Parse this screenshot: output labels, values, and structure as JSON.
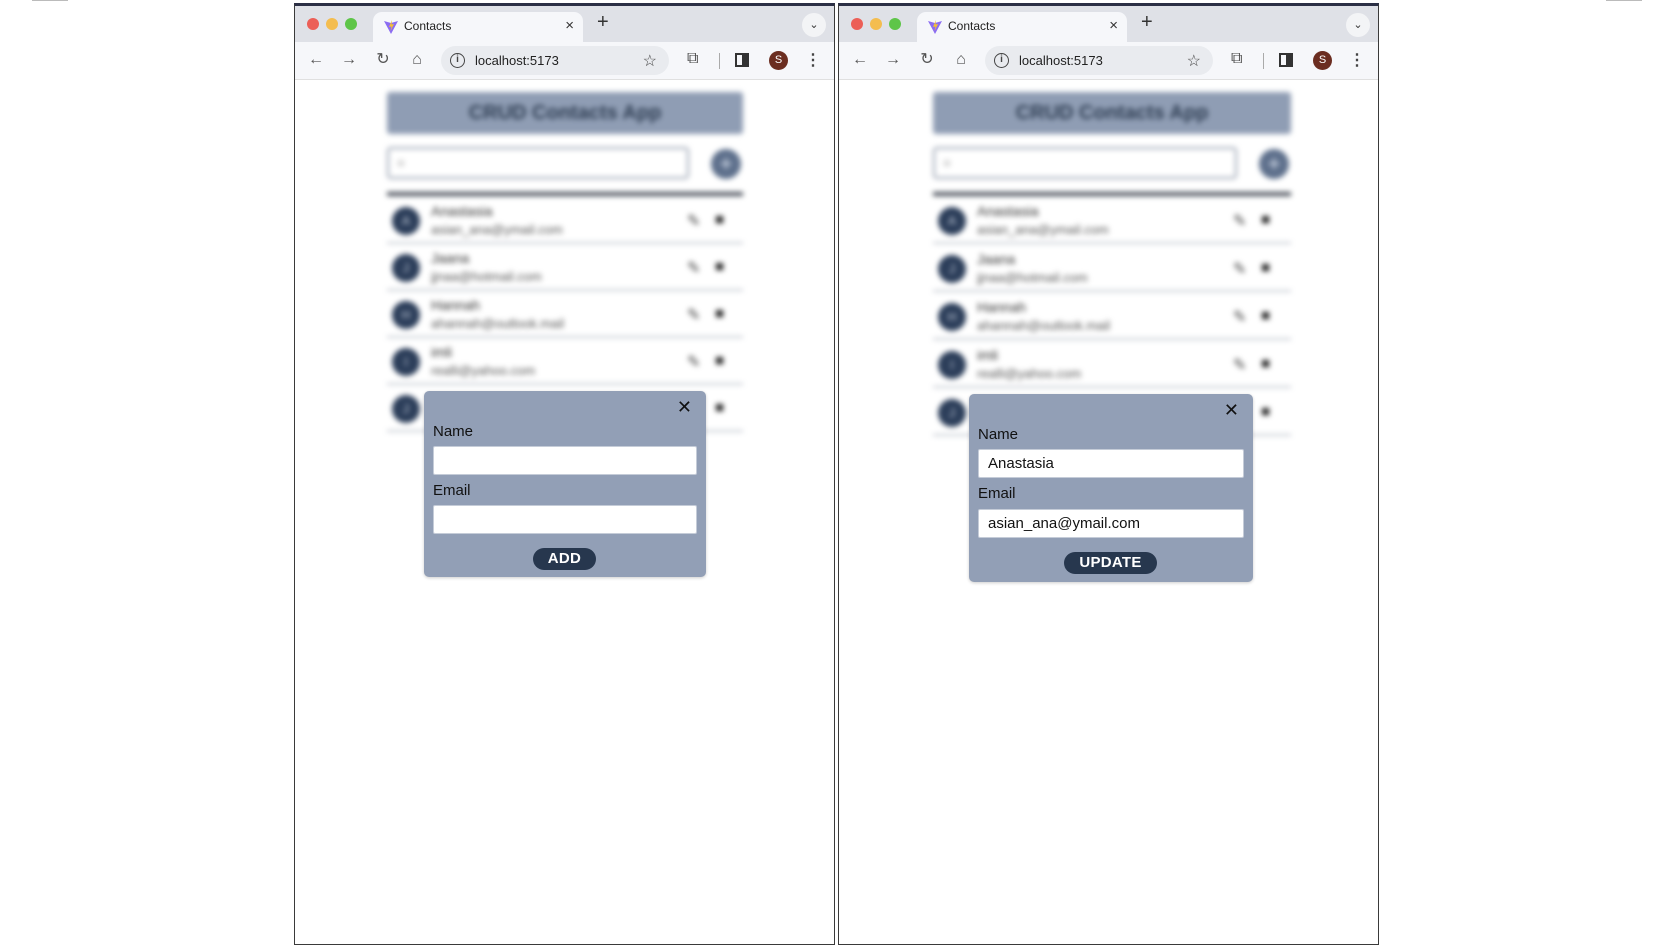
{
  "browser_left": {
    "tab_title": "Contacts",
    "url": "localhost:5173",
    "profile_initial": "S",
    "app": {
      "title": "CRUD Contacts App",
      "contacts": [
        {
          "initial": "A",
          "name": "Anastasia",
          "email": "asian_ana@ymail.com"
        },
        {
          "initial": "J",
          "name": "Jaana",
          "email": "jjnaa@hotmail.com"
        },
        {
          "initial": "H",
          "name": "Hannah",
          "email": "ahannah@outlook.mail"
        },
        {
          "initial": "I",
          "name": "imli",
          "email": "realli@yahoo.com"
        },
        {
          "initial": "J",
          "name": "",
          "email": ""
        }
      ]
    },
    "modal": {
      "name_label": "Name",
      "name_value": "",
      "email_label": "Email",
      "email_value": "",
      "button_label": "ADD"
    }
  },
  "browser_right": {
    "tab_title": "Contacts",
    "url": "localhost:5173",
    "profile_initial": "S",
    "app": {
      "title": "CRUD Contacts App",
      "contacts": [
        {
          "initial": "A",
          "name": "Anastasia",
          "email": "asian_ana@ymail.com"
        },
        {
          "initial": "J",
          "name": "Jaana",
          "email": "jjnaa@hotmail.com"
        },
        {
          "initial": "H",
          "name": "Hannah",
          "email": "ahannah@outlook.mail"
        },
        {
          "initial": "I",
          "name": "imli",
          "email": "realli@yahoo.com"
        },
        {
          "initial": "J",
          "name": "",
          "email": ""
        }
      ]
    },
    "modal": {
      "name_label": "Name",
      "name_value": "Anastasia",
      "email_label": "Email",
      "email_value": "asian_ana@ymail.com",
      "button_label": "UPDATE"
    }
  },
  "icons": {
    "close": "close-icon",
    "search": "search-icon",
    "add": "plus-icon",
    "edit": "pencil-icon",
    "delete": "trash-icon"
  },
  "colors": {
    "header_bg": "#8f9db4",
    "modal_bg": "#929fb6",
    "button_bg": "#27374e",
    "avatar_bg": "#2c3e5a"
  }
}
